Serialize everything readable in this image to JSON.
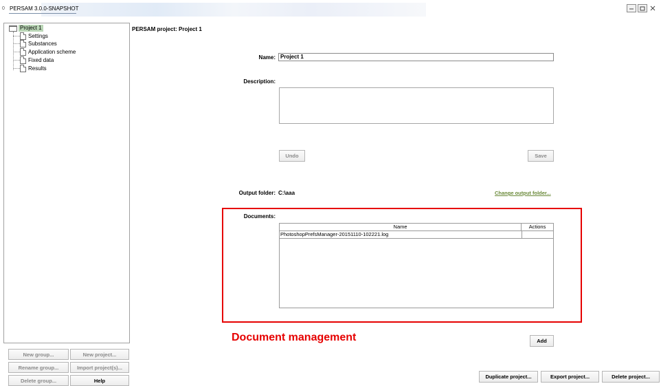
{
  "window": {
    "title": "PERSAM 3.0.0-SNAPSHOT",
    "app_icon_text": "0",
    "minimize_icon": "minimize-icon",
    "maximize_icon": "maximize-icon",
    "close_icon": "close-icon"
  },
  "tree": {
    "root": "Project 1",
    "items": [
      {
        "label": "Settings"
      },
      {
        "label": "Substances"
      },
      {
        "label": "Application scheme"
      },
      {
        "label": "Fixed data"
      },
      {
        "label": "Results"
      }
    ]
  },
  "left_buttons": {
    "new_group": "New group...",
    "new_project": "New project...",
    "rename_group": "Rename group...",
    "import_projects": "Import project(s)...",
    "delete_group": "Delete group...",
    "help": "Help"
  },
  "main": {
    "header": "PERSAM project: Project 1",
    "name_label": "Name:",
    "name_value": "Project 1",
    "description_label": "Description:",
    "undo_label": "Undo",
    "save_label": "Save",
    "output_folder_label": "Output folder:",
    "output_folder_value": "C:\\aaa",
    "change_output_label": "Change output folder...",
    "documents_label": "Documents:",
    "documents": {
      "columns": [
        "Name",
        "Actions"
      ],
      "rows": [
        {
          "name": "PhotoshopPrefsManager-20151110-102221.log",
          "actions": ""
        }
      ]
    },
    "add_label": "Add",
    "duplicate_label": "Duplicate project...",
    "export_label": "Export project...",
    "delete_label": "Delete project..."
  },
  "annotation": {
    "text": "Document management",
    "color": "#e60000"
  },
  "colors": {
    "selection": "#b9d5b5",
    "link": "#6b8a3a"
  }
}
